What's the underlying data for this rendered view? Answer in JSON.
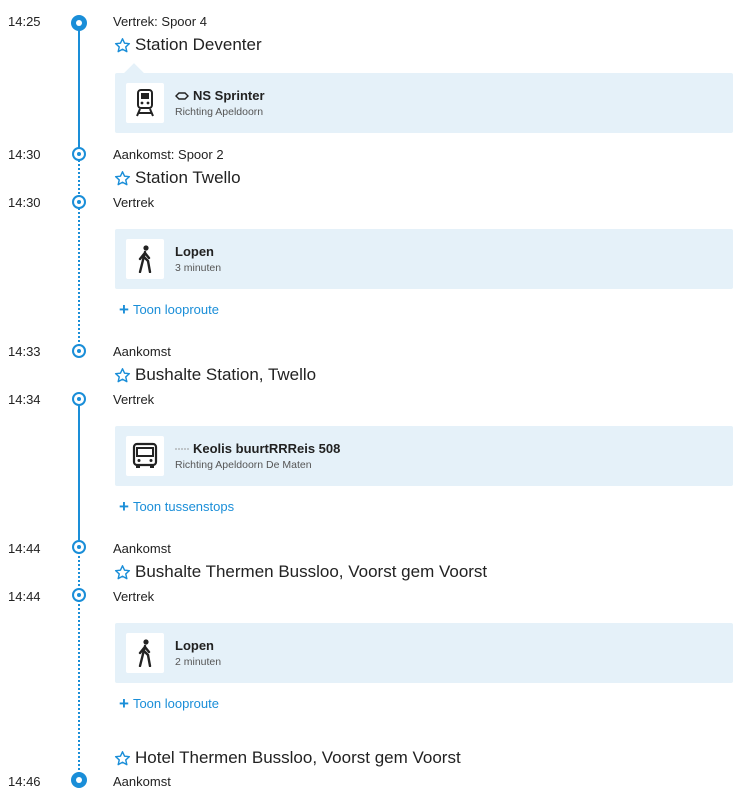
{
  "colors": {
    "accent": "#1a8ed8",
    "card_bg": "#e5f1f9"
  },
  "legs": [
    {
      "time": "14:25",
      "label": "Vertrek: Spoor 4",
      "stop": "Station Deventer"
    },
    {
      "card": {
        "icon": "train-icon",
        "title": "NS Sprinter",
        "operator_icon": "ns-logo-icon",
        "sub": "Richting Apeldoorn"
      }
    },
    {
      "time": "14:30",
      "label": "Aankomst: Spoor 2",
      "stop": "Station Twello"
    },
    {
      "time": "14:30",
      "label": "Vertrek"
    },
    {
      "card": {
        "icon": "walking-icon",
        "title": "Lopen",
        "sub": "3 minuten"
      }
    },
    {
      "link": "Toon looproute"
    },
    {
      "time": "14:33",
      "label": "Aankomst",
      "stop": "Bushalte Station, Twello"
    },
    {
      "time": "14:34",
      "label": "Vertrek"
    },
    {
      "card": {
        "icon": "bus-icon",
        "title": "Keolis buurtRRReis 508",
        "operator_icon": "keolis-logo-icon",
        "sub": "Richting Apeldoorn De Maten"
      }
    },
    {
      "link": "Toon tussenstops"
    },
    {
      "time": "14:44",
      "label": "Aankomst",
      "stop": "Bushalte Thermen Bussloo, Voorst gem Voorst"
    },
    {
      "time": "14:44",
      "label": "Vertrek"
    },
    {
      "card": {
        "icon": "walking-icon",
        "title": "Lopen",
        "sub": "2 minuten"
      }
    },
    {
      "link": "Toon looproute"
    },
    {
      "stop": "Hotel Thermen Bussloo, Voorst gem Voorst"
    },
    {
      "time": "14:46",
      "label": "Aankomst"
    }
  ]
}
